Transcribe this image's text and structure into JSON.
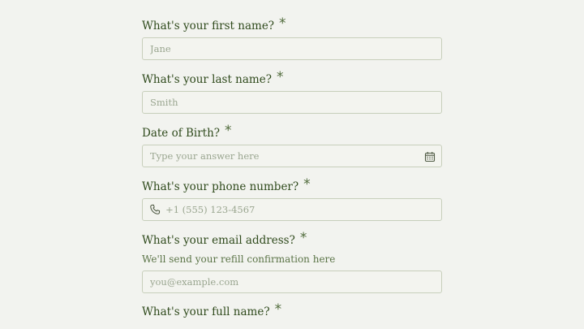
{
  "form": {
    "first_name": {
      "label": "What's your first name?",
      "required_mark": "*",
      "placeholder": "Jane"
    },
    "last_name": {
      "label": "What's your last name?",
      "required_mark": "*",
      "placeholder": "Smith"
    },
    "dob": {
      "label": "Date of Birth?",
      "required_mark": "*",
      "placeholder": "Type your answer here",
      "icon": "calendar-icon"
    },
    "phone": {
      "label": "What's your phone number?",
      "required_mark": "*",
      "placeholder": "+1 (555) 123-4567",
      "icon": "phone-icon"
    },
    "email": {
      "label": "What's your email address?",
      "required_mark": "*",
      "helper": "We'll send your refill confirmation here",
      "placeholder": "you@example.com"
    },
    "full_name": {
      "label": "What's your full name?",
      "required_mark": "*"
    }
  },
  "colors": {
    "background": "#f2f3ef",
    "label": "#2f4a1c",
    "border": "#c7cfbb",
    "placeholder": "#9aa690"
  }
}
